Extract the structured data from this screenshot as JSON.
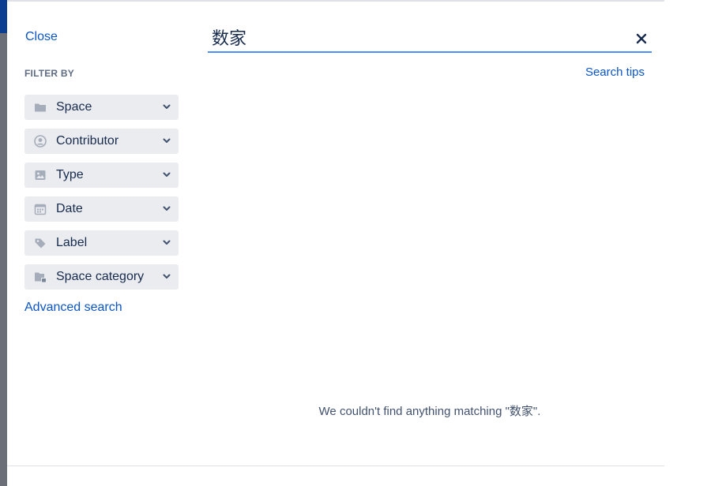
{
  "panel": {
    "close_label": "Close",
    "filter_heading": "FILTER BY",
    "filters": [
      {
        "label": "Space",
        "icon": "folder-icon"
      },
      {
        "label": "Contributor",
        "icon": "user-icon"
      },
      {
        "label": "Type",
        "icon": "image-icon"
      },
      {
        "label": "Date",
        "icon": "calendar-icon"
      },
      {
        "label": "Label",
        "icon": "tag-icon"
      },
      {
        "label": "Space category",
        "icon": "space-category-icon"
      }
    ],
    "advanced_search_label": "Advanced search"
  },
  "search": {
    "query": "数家",
    "tips_label": "Search tips",
    "empty_message": "We couldn't find anything matching \"数家\"."
  },
  "colors": {
    "link": "#0c55c5",
    "input_underline": "#4c8df6",
    "filter_bg": "#ebecf0",
    "icon": "#a5adba"
  }
}
